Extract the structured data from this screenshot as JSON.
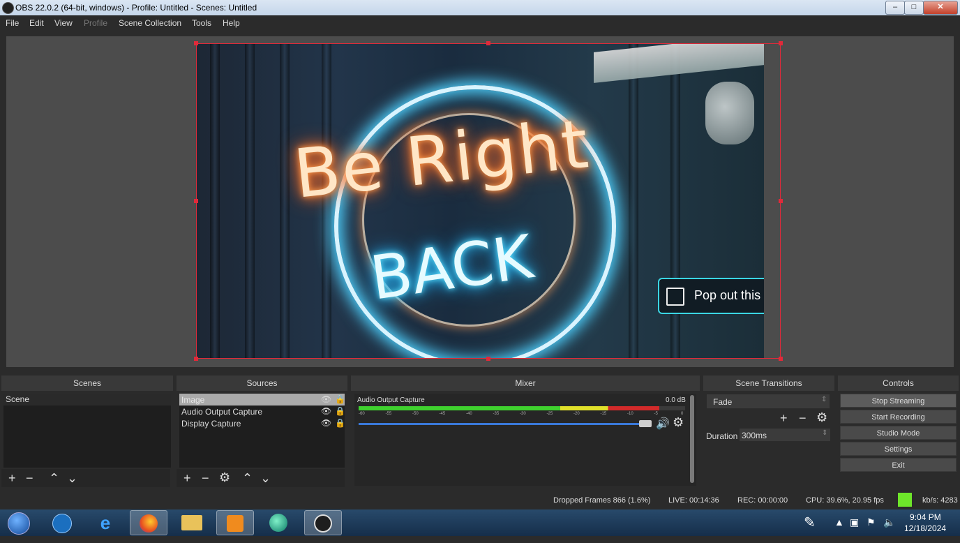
{
  "window": {
    "title": "OBS 22.0.2 (64-bit, windows) - Profile: Untitled - Scenes: Untitled",
    "minimize": "–",
    "maximize": "□",
    "close": "✕"
  },
  "menu": [
    {
      "label": "File",
      "enabled": true
    },
    {
      "label": "Edit",
      "enabled": true
    },
    {
      "label": "View",
      "enabled": true
    },
    {
      "label": "Profile",
      "enabled": false
    },
    {
      "label": "Scene Collection",
      "enabled": true
    },
    {
      "label": "Tools",
      "enabled": true
    },
    {
      "label": "Help",
      "enabled": true
    }
  ],
  "preview": {
    "neon_line1": "Be Right",
    "neon_line2": "BACK",
    "popout_label": "Pop out this"
  },
  "scenes": {
    "title": "Scenes",
    "items": [
      "Scene"
    ],
    "toolbar_icons": [
      "plus-icon",
      "minus-icon",
      "arrow-up-icon",
      "arrow-down-icon"
    ]
  },
  "sources": {
    "title": "Sources",
    "items": [
      {
        "label": "Image",
        "selected": true
      },
      {
        "label": "Audio Output Capture",
        "selected": false
      },
      {
        "label": "Display Capture",
        "selected": false
      }
    ],
    "toolbar_icons": [
      "plus-icon",
      "minus-icon",
      "gear-icon",
      "arrow-up-icon",
      "arrow-down-icon"
    ]
  },
  "mixer": {
    "title": "Mixer",
    "track_name": "Audio Output Capture",
    "db": "0.0 dB",
    "scale": [
      "-60",
      "-55",
      "-50",
      "-45",
      "-40",
      "-35",
      "-30",
      "-25",
      "-20",
      "-15",
      "-10",
      "-5",
      "0"
    ],
    "volume_level": 1.0,
    "meter_level": 0.92
  },
  "transitions": {
    "title": "Scene Transitions",
    "selected": "Fade",
    "duration_label": "Duration",
    "duration_value": "300ms"
  },
  "controls": {
    "title": "Controls",
    "buttons": [
      "Stop Streaming",
      "Start Recording",
      "Studio Mode",
      "Settings",
      "Exit"
    ]
  },
  "status": {
    "dropped": "Dropped Frames 866 (1.6%)",
    "live": "LIVE: 00:14:36",
    "rec": "REC: 00:00:00",
    "cpu": "CPU: 39.6%, 20.95 fps",
    "kbps": "kb/s: 4283",
    "health_color": "#6ee62a"
  },
  "taskbar": {
    "apps": [
      "start-orb",
      "hp-icon",
      "ie-icon",
      "firefox-icon",
      "explorer-icon",
      "media-player-icon",
      "globe-app-icon",
      "obs-icon"
    ],
    "time": "9:04 PM",
    "date": "12/18/2024"
  },
  "colors": {
    "selection_border": "#e02a3a",
    "meter_green": "#3fd12e",
    "meter_yellow": "#e0e02a",
    "meter_red": "#d22a2a",
    "fader_blue": "#3a78d8"
  }
}
